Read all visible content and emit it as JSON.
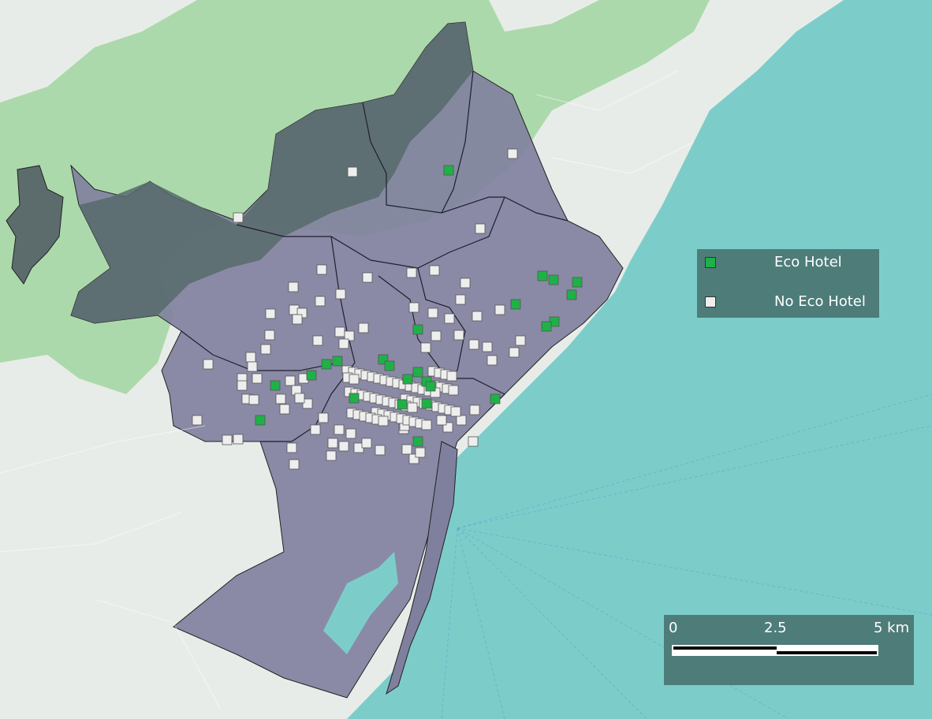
{
  "map": {
    "colors": {
      "land": "#e7ece7",
      "forest": "#a9dba9",
      "sea": "#7ccdca",
      "city_fill": "#7f7f9e",
      "district_line": "#222222",
      "eco": "#1fb147",
      "no_eco": "#eeeeee",
      "legend_bg": "#4d7c79"
    }
  },
  "legend": {
    "eco_label": "Eco Hotel",
    "no_eco_label": "No Eco Hotel"
  },
  "scale": {
    "label_0": "0",
    "label_mid": "2.5",
    "label_end": "5 km"
  }
}
